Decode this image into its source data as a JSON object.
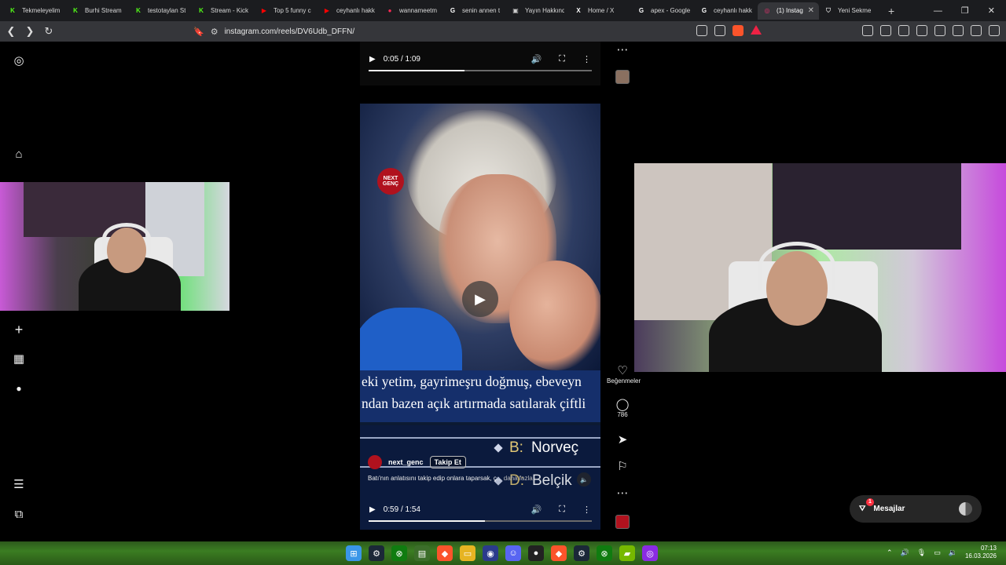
{
  "browser": {
    "tabs": [
      {
        "label": "Tekmeleyelim",
        "icon": "kick-icon",
        "color": "#53fc18",
        "glyph": "K"
      },
      {
        "label": "Burhi Stream",
        "icon": "kick-icon",
        "color": "#53fc18",
        "glyph": "K"
      },
      {
        "label": "testotaylan St",
        "icon": "kick-icon",
        "color": "#53fc18",
        "glyph": "K"
      },
      {
        "label": "Stream - Kick",
        "icon": "kick-icon",
        "color": "#53fc18",
        "glyph": "K"
      },
      {
        "label": "Top 5 funny c",
        "icon": "youtube-icon",
        "color": "#ff0000",
        "glyph": "▶"
      },
      {
        "label": "ceyhanlı hakk",
        "icon": "youtube-icon",
        "color": "#ff0000",
        "glyph": "▶"
      },
      {
        "label": "wannameetm",
        "icon": "record-icon",
        "color": "#ff2a55",
        "glyph": "●"
      },
      {
        "label": "senin annen t",
        "icon": "google-icon",
        "color": "#ffffff",
        "glyph": "G"
      },
      {
        "label": "Yayın Hakkınd",
        "icon": "page-icon",
        "color": "#cccccc",
        "glyph": "▣"
      },
      {
        "label": "Home / X",
        "icon": "x-icon",
        "color": "#ffffff",
        "glyph": "X"
      },
      {
        "label": "apex - Google",
        "icon": "google-icon",
        "color": "#ffffff",
        "glyph": "G"
      },
      {
        "label": "ceyhanlı hakk",
        "icon": "google-icon",
        "color": "#ffffff",
        "glyph": "G"
      },
      {
        "label": "(1) Instag",
        "icon": "instagram-icon",
        "color": "#e1306c",
        "glyph": "◎",
        "active": true
      },
      {
        "label": "Yeni Sekme",
        "icon": "shield-icon",
        "color": "#cccccc",
        "glyph": "⛉"
      }
    ],
    "url": "instagram.com/reels/DV6Udb_DFFN/"
  },
  "reel_top": {
    "time": "0:05 / 1:09",
    "progress": 0.43
  },
  "reel_main": {
    "subtitle_line1": "eki yetim, gayrimeşru doğmuş, ebeveyn",
    "subtitle_line2": "ndan bazen açık artırmada satılarak çiftli",
    "option_b": {
      "letter": "B:",
      "answer": "Norveç"
    },
    "option_d": {
      "letter": "D:",
      "answer": "Belçik"
    },
    "badge_text": "NEXT GENÇ",
    "author": "next_genc",
    "follow_label": "Takip Et",
    "caption": "Batı'nın anlatısını takip edip onlara taparsak, ç...",
    "caption_more": "daha fazla",
    "time": "0:59 / 1:54",
    "progress": 0.52
  },
  "actions": {
    "likes_label": "Beğenmeler",
    "comments_count": "786"
  },
  "messages": {
    "label": "Mesajlar",
    "badge": "1"
  },
  "taskbar": {
    "time": "07:13",
    "date": "16.03.2026"
  }
}
